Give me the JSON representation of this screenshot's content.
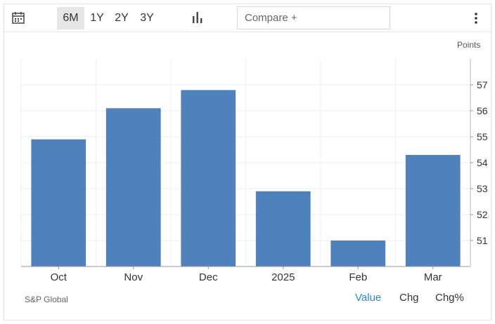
{
  "toolbar": {
    "ranges": [
      "6M",
      "1Y",
      "2Y",
      "3Y"
    ],
    "active_range": "6M",
    "compare_placeholder": "Compare +",
    "icons": [
      "calendar-icon",
      "bar-chart-icon",
      "more-vertical-icon"
    ]
  },
  "chart_data": {
    "type": "bar",
    "unit_label": "Points",
    "categories": [
      "Oct",
      "Nov",
      "Dec",
      "2025",
      "Feb",
      "Mar"
    ],
    "values": [
      54.9,
      56.1,
      56.8,
      52.9,
      51.0,
      54.3
    ],
    "yticks": [
      51,
      52,
      53,
      54,
      55,
      56,
      57
    ],
    "ylim": [
      50.0,
      58.0
    ],
    "bar_color": "#4f81bd",
    "grid": true
  },
  "footer": {
    "source": "S&P Global",
    "modes": [
      "Value",
      "Chg",
      "Chg%"
    ],
    "active_mode": "Value",
    "active_color": "#2e87d6"
  }
}
